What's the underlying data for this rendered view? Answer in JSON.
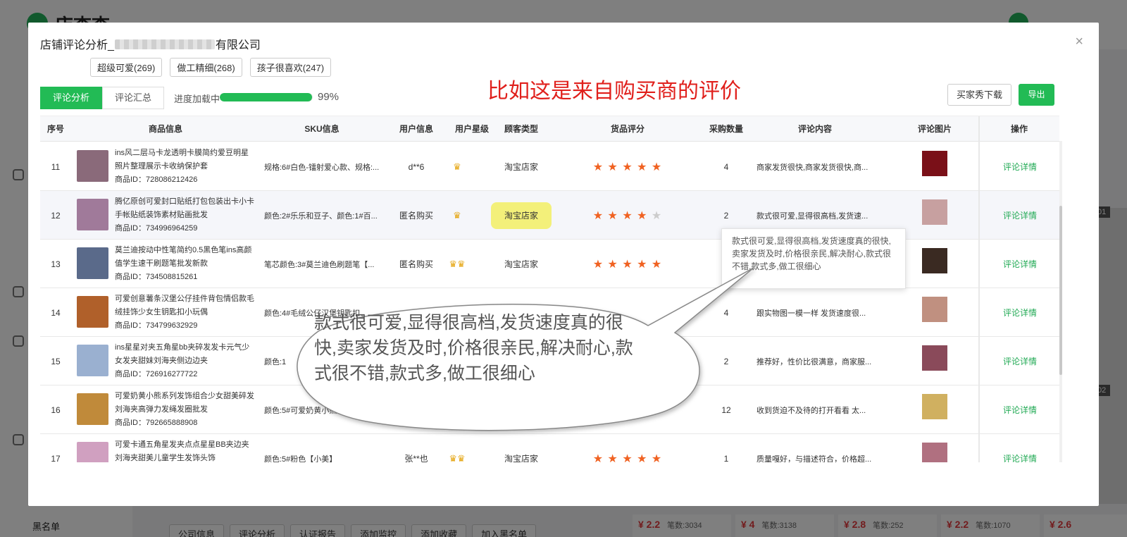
{
  "background": {
    "logo_text": "店查查",
    "blacklist_label": "黑名单",
    "actions": [
      "公司信息",
      "评论分析",
      "认证报告",
      "添加监控",
      "添加收藏",
      "加入黑名单"
    ],
    "prices": [
      {
        "price": "¥ 2.2",
        "sales": "笔数:3034"
      },
      {
        "price": "¥ 4",
        "sales": "笔数:3138"
      },
      {
        "price": "¥ 2.8",
        "sales": "笔数:252"
      },
      {
        "price": "¥ 2.2",
        "sales": "笔数:1070"
      },
      {
        "price": "¥ 2.6",
        "sales": ""
      }
    ],
    "tags": [
      "01",
      "02"
    ]
  },
  "modal": {
    "title_prefix": "店铺评论分析_",
    "title_suffix": "有限公司",
    "close": "×"
  },
  "tags": [
    "超级可爱(269)",
    "做工精细(268)",
    "孩子很喜欢(247)"
  ],
  "tabs": [
    "评论分析",
    "评论汇总"
  ],
  "progress": {
    "label": "进度加载中",
    "value": 0.99,
    "percent_text": "99%"
  },
  "annotation": "比如这是来自购买商的评价",
  "buttons": {
    "download": "买家秀下载",
    "export": "导出"
  },
  "columns": [
    "序号",
    "商品信息",
    "SKU信息",
    "用户信息",
    "用户星级",
    "顾客类型",
    "货品评分",
    "采购数量",
    "评论内容",
    "评论图片",
    "操作"
  ],
  "rows": [
    {
      "index": "11",
      "title": "ins风二层马卡龙透明卡膜简约爱豆明星照片整理展示卡收纳保护套",
      "id": "商品ID：728086212426",
      "sku": "规格:6#白色-镭射爱心款、规格:...",
      "user": "d**6",
      "star_level": "♛",
      "customer_type": "淘宝店家",
      "rating": 5,
      "qty": "4",
      "comment": "商家发货很快,商家发货很快,商...",
      "op": "评论详情",
      "thumb_color": "#8a6a7a",
      "img_color": "#7a1018"
    },
    {
      "index": "12",
      "title": "腾亿原创可爱封口贴纸打包包装出卡小卡手帐贴纸装饰素材贴画批发",
      "id": "商品ID：734996964259",
      "sku": "颜色:2#乐乐和豆子、颜色:1#百...",
      "user": "匿名购买",
      "star_level": "♛",
      "customer_type": "淘宝店家",
      "rating": 4,
      "qty": "2",
      "comment": "款式很可爱,显得很高档,发货速...",
      "op": "评论详情",
      "thumb_color": "#a07a9a",
      "img_color": "#c7a0a0"
    },
    {
      "index": "13",
      "title": "莫兰迪按动中性笔简约0.5黑色笔ins高颜值学生速干刷题笔批发新款",
      "id": "商品ID：734508815261",
      "sku": "笔芯颜色:3#莫兰迪色刷题笔【...",
      "user": "匿名购买",
      "star_level": "♛♛",
      "customer_type": "淘宝店家",
      "rating": 5,
      "qty": "",
      "comment": "",
      "op": "评论详情",
      "thumb_color": "#5a6a8a",
      "img_color": "#3a2a22"
    },
    {
      "index": "14",
      "title": "可爱创意薯条汉堡公仔挂件背包情侣款毛绒挂饰少女生钥匙扣小玩偶",
      "id": "商品ID：734799632929",
      "sku": "颜色:4#毛绒公仔汉堡钥匙扣、...",
      "user": "",
      "star_level": "",
      "customer_type": "",
      "rating": 0,
      "qty": "4",
      "comment": "跟实物图一模一样 发货速度很...",
      "op": "评论详情",
      "thumb_color": "#b0602a",
      "img_color": "#c09080"
    },
    {
      "index": "15",
      "title": "ins星星对夹五角星bb夹碎发发卡元气少女发夹甜妹刘海夹侧边边夹",
      "id": "商品ID：726916277722",
      "sku": "颜色:1",
      "user": "",
      "star_level": "",
      "customer_type": "",
      "rating": 0,
      "qty": "2",
      "comment": "推荐好，性价比很满意，商家服...",
      "op": "评论详情",
      "thumb_color": "#9ab0d0",
      "img_color": "#8a4a5a"
    },
    {
      "index": "16",
      "title": "可爱奶黄小熊系列发饰组合少女甜美碎发刘海夹高弹力发绳发圈批发",
      "id": "商品ID：792665888908",
      "sku": "颜色:5#可爱奶黄小熊盒装",
      "user": "",
      "star_level": "",
      "customer_type": "",
      "rating": 0,
      "qty": "12",
      "comment": "收到货迫不及待的打开看看 太...",
      "op": "评论详情",
      "thumb_color": "#c08a3a",
      "img_color": "#d0b060"
    },
    {
      "index": "17",
      "title": "可爱卡通五角星发夹点点星星BB夹边夹刘海夹甜美儿童学生发饰头饰",
      "id": "",
      "sku": "颜色:5#粉色【小美】",
      "user": "张**也",
      "star_level": "♛♛",
      "customer_type": "淘宝店家",
      "rating": 5,
      "qty": "1",
      "comment": "质量嘎好，与描述符合，价格超...",
      "op": "评论详情",
      "thumb_color": "#d0a0c0",
      "img_color": "#b07080"
    }
  ],
  "tooltip": "款式很可爱,显得很高档,发货速度真的很快,卖家发货及时,价格很亲民,解决耐心,款式很不错,款式多,做工很细心",
  "bubble": "款式很可爱,显得很高档,发货速度真的很快,卖家发货及时,价格很亲民,解决耐心,款式很不错,款式多,做工很细心",
  "colors": {
    "accent": "#22bb55",
    "annotation": "#e0201c",
    "star": "#f06222",
    "highlight": "#f3f07a"
  }
}
